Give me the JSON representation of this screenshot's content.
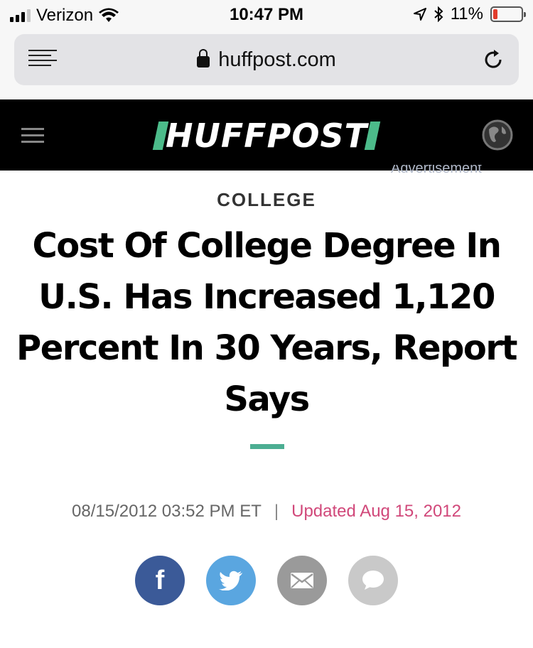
{
  "status_bar": {
    "carrier": "Verizon",
    "time": "10:47 PM",
    "battery": "11%",
    "battery_level": 0.11,
    "icons": [
      "signal-icon",
      "wifi-icon",
      "location-icon",
      "bluetooth-icon",
      "battery-icon"
    ]
  },
  "browser": {
    "url": "huffpost.com",
    "icons": [
      "reader-icon",
      "lock-icon",
      "reload-icon"
    ]
  },
  "site_header": {
    "logo": "HUFFPOST",
    "icons": [
      "menu-icon",
      "globe-icon"
    ]
  },
  "article": {
    "ad_peek": "Advertisement",
    "category": "COLLEGE",
    "headline": "Cost Of College Degree In U.S. Has Increased 1,120 Percent In 30 Years, Report Says",
    "published": "08/15/2012 03:52 PM ET",
    "separator": "|",
    "updated": "Updated Aug 15, 2012"
  },
  "share": {
    "buttons": [
      {
        "name": "facebook",
        "icon": "facebook-icon",
        "glyph": "f",
        "color": "#3b5a98"
      },
      {
        "name": "twitter",
        "icon": "twitter-icon",
        "color": "#5aa6e0"
      },
      {
        "name": "email",
        "icon": "email-icon",
        "color": "#9a9a9a"
      },
      {
        "name": "comments",
        "icon": "comment-icon",
        "color": "#c9c9c9"
      }
    ]
  },
  "colors": {
    "accent_green": "#4cbb8a",
    "updated_pink": "#d1487a",
    "header_bg": "#000000"
  }
}
